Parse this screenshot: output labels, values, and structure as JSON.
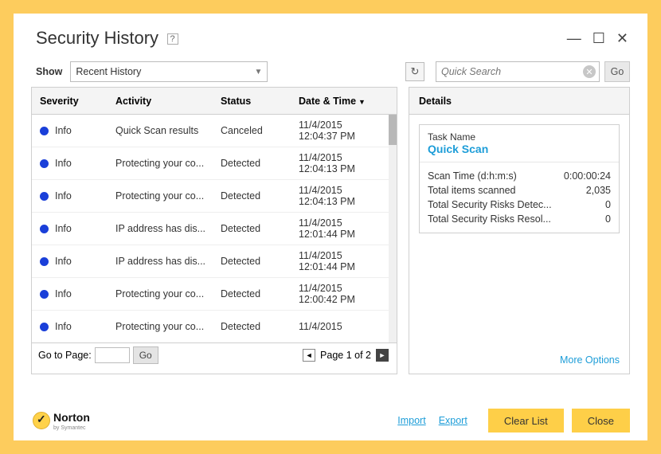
{
  "window": {
    "title": "Security History"
  },
  "toolbar": {
    "show_label": "Show",
    "dropdown_value": "Recent History",
    "search_placeholder": "Quick Search",
    "go_label": "Go"
  },
  "table": {
    "headers": {
      "severity": "Severity",
      "activity": "Activity",
      "status": "Status",
      "datetime": "Date & Time"
    },
    "rows": [
      {
        "severity": "Info",
        "activity": "Quick Scan results",
        "status": "Canceled",
        "date": "11/4/2015",
        "time": "12:04:37 PM"
      },
      {
        "severity": "Info",
        "activity": "Protecting your co...",
        "status": "Detected",
        "date": "11/4/2015",
        "time": "12:04:13 PM"
      },
      {
        "severity": "Info",
        "activity": "Protecting your co...",
        "status": "Detected",
        "date": "11/4/2015",
        "time": "12:04:13 PM"
      },
      {
        "severity": "Info",
        "activity": "IP address has dis...",
        "status": "Detected",
        "date": "11/4/2015",
        "time": "12:01:44 PM"
      },
      {
        "severity": "Info",
        "activity": "IP address has dis...",
        "status": "Detected",
        "date": "11/4/2015",
        "time": "12:01:44 PM"
      },
      {
        "severity": "Info",
        "activity": "Protecting your co...",
        "status": "Detected",
        "date": "11/4/2015",
        "time": "12:00:42 PM"
      },
      {
        "severity": "Info",
        "activity": "Protecting your co...",
        "status": "Detected",
        "date": "11/4/2015",
        "time": ""
      }
    ],
    "pager": {
      "goto_label": "Go to Page:",
      "go_label": "Go",
      "page_text": "Page 1 of 2"
    }
  },
  "details": {
    "header": "Details",
    "task_label": "Task Name",
    "task_value": "Quick Scan",
    "stats": [
      {
        "label": "Scan Time (d:h:m:s)",
        "value": "0:00:00:24"
      },
      {
        "label": "Total items scanned",
        "value": "2,035"
      },
      {
        "label": "Total Security Risks Detec...",
        "value": "0"
      },
      {
        "label": "Total Security Risks Resol...",
        "value": "0"
      }
    ],
    "more_options": "More Options"
  },
  "footer": {
    "brand": "Norton",
    "sub": "by Symantec",
    "import": "Import",
    "export": "Export",
    "clear": "Clear List",
    "close": "Close"
  }
}
